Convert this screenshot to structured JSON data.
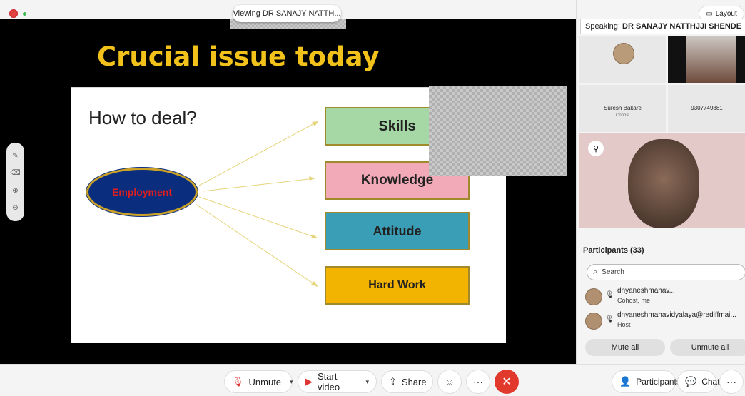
{
  "window": {
    "viewing_label": "Viewing DR SANAJY NATTH..."
  },
  "shared_content": {
    "title": "Crucial issue today",
    "slide": {
      "heading": "How to deal?",
      "center_label": "Employment",
      "boxes": [
        {
          "label": "Skills",
          "color": "#a6d8a6"
        },
        {
          "label": "Knowledge",
          "color": "#f2a9b8"
        },
        {
          "label": "Attitude",
          "color": "#3a9fb6"
        },
        {
          "label": "Hard Work",
          "color": "#f2b400"
        }
      ]
    }
  },
  "zoom_tools": [
    "annotate-icon",
    "erase-icon",
    "zoom-in-icon",
    "zoom-out-icon"
  ],
  "right_panel": {
    "layout_label": "Layout",
    "speaking_prefix": "Speaking:",
    "speaking_name": "DR SANAJY NATTHJJI SHENDE",
    "tiles": [
      {
        "name": "Suresh Bakare",
        "role": "Cohost"
      },
      {
        "name": "9307749881",
        "role": ""
      }
    ],
    "participants": {
      "header": "Participants (33)",
      "search_placeholder": "Search",
      "list": [
        {
          "name": "dnyaneshmahav...",
          "role": "Cohost, me"
        },
        {
          "name": "dnyaneshmahavidyalaya@rediffmai...",
          "role": "Host"
        }
      ],
      "mute_all": "Mute all",
      "unmute_all": "Unmute all"
    }
  },
  "toolbar": {
    "unmute": "Unmute",
    "start_video": "Start video",
    "share": "Share",
    "more": "···",
    "participants": "Participants",
    "chat": "Chat",
    "overflow": "···"
  }
}
